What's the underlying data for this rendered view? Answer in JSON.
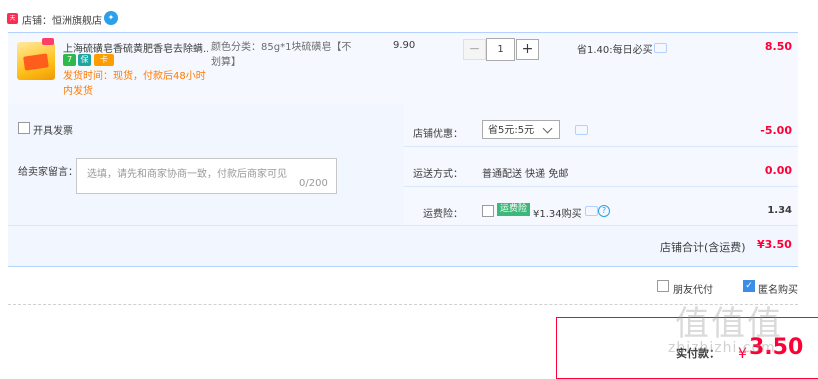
{
  "shop": {
    "badge": "天猫",
    "label": "店铺：恒洲旗舰店",
    "chat_icon": "ww-chat-icon"
  },
  "item": {
    "title": "上海硫磺皂香硫黄肥香皂去除螨...",
    "badges": [
      "7",
      "保",
      "卡"
    ],
    "ship_time": "发货时间：现货，付款后48小时内发货",
    "sku": "颜色分类：85g*1块硫磺皂【不划算】",
    "unit_price": "9.90",
    "qty_minus": "−",
    "quantity": "1",
    "qty_plus": "+",
    "save_info": "省1.40:每日必买",
    "total": "8.50"
  },
  "options": {
    "invoice_label": "开具发票",
    "message_label": "给卖家留言：",
    "message_placeholder": "选填，请先和商家协商一致，付款后商家可见",
    "message_count": "0/200",
    "coupon_label": "店铺优惠：",
    "coupon_selected": "省5元:5元",
    "coupon_value": "-5.00",
    "shipping_label": "运送方式：",
    "shipping_text": "普通配送 快递 免邮",
    "shipping_value": "0.00",
    "insurance_label": "运费险：",
    "insurance_tag": "运费险",
    "insurance_amount": "¥1.34购买",
    "insurance_value": "1.34"
  },
  "shop_total": {
    "label": "店铺合计(含运费)",
    "value": "¥3.50"
  },
  "footer": {
    "friend_pay_label": "朋友代付",
    "anonymous_label": "匿名购买",
    "anonymous_checked": "✓",
    "pay_label": "实付款：",
    "pay_currency": "¥",
    "pay_amount": "3.50"
  },
  "watermark": {
    "main": "值值值",
    "sub": "zhizhizhi.com"
  },
  "colors": {
    "accent_red": "#ff0036",
    "border_blue": "#b2d1ff",
    "bg_blue": "#f2f7ff"
  }
}
